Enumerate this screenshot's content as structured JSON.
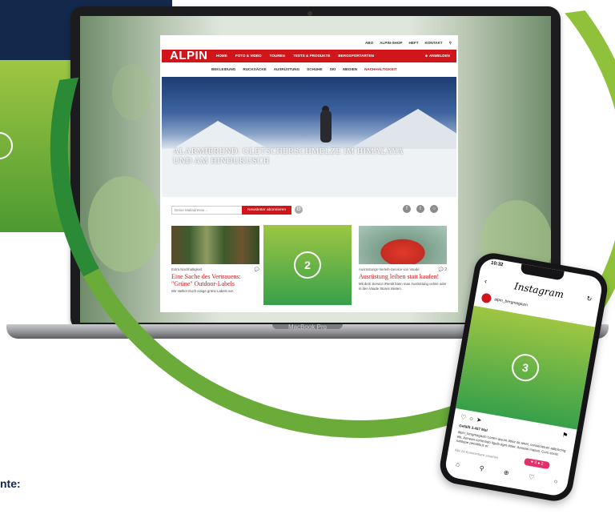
{
  "website": {
    "logo": "ALPIN",
    "top_nav": [
      "ABO",
      "ALPIN-SHOP",
      "HEFT",
      "KONTAKT"
    ],
    "main_nav": [
      "HOME",
      "FOTO & VIDEO",
      "TOUREN",
      "TESTS & PRODUKTE",
      "BERGSPORTARTEN"
    ],
    "login": "ANMELDEN",
    "sub_nav": [
      "BEKLEIDUNG",
      "RUCKSÄCKE",
      "AUSRÜSTUNG",
      "SCHUHE",
      "SKI",
      "MEDIEN",
      "NACHHALTIGKEIT"
    ],
    "hero": {
      "title": "ALARMIEREND: GLETSCHERSCHMELZE IM HIMALAYA UND AM HINDUKUSCH"
    },
    "newsletter": {
      "placeholder": "Deine Mailadresse...",
      "button": "Newsletter abonnieren"
    },
    "cards": [
      {
        "kicker": "Extra Nachhaltigkeit",
        "title": "Eine Sache des Vertrauens: \"Grüne\" Outdoor-Labels",
        "text": "Wir stellen Euch einige grüne Labels vor."
      },
      {
        "kicker": "Ausrüstungs-Verleih-Service von Vaude",
        "title": "Ausrüstung leihen statt kaufen!",
        "text": "Mit dem Service iRentit kann man Ausrüstung online oder in den Vaude Stores mieten.",
        "comments": "2"
      }
    ],
    "placeholder_label": "2"
  },
  "laptop_label": "MacBook Pro",
  "phone": {
    "time": "10:32",
    "app_title": "Instagram",
    "handle": "alpin_bergmagazin",
    "likes": "Gefällt 3.457 Mal",
    "caption": "alpin_bergmagazin Lorem ipsum dolor sit amet, consectetuer adipiscing elit. Aenean commodo ligula eget dolor. Aenean massa. Cum sociis natoque penatibus et",
    "comments_link": "Alle 24 Kommentare ansehen",
    "badge": "♥ 3  ● 2",
    "placeholder_label": "3"
  },
  "background": {
    "circle_label": ""
  },
  "footer_partial": "nte:",
  "colors": {
    "brand_red": "#d0161b",
    "navy": "#13294b",
    "green_light": "#9ec642",
    "green_dark": "#37a04a"
  }
}
